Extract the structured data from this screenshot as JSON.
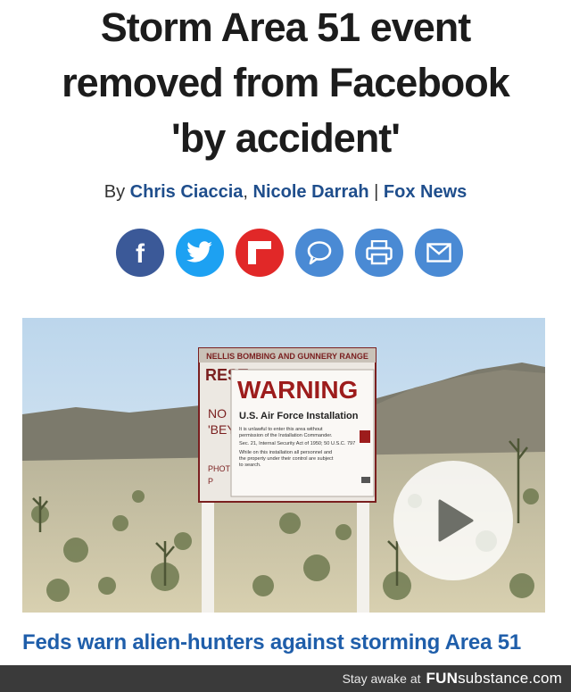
{
  "article": {
    "headline_line1": "Storm Area 51 event",
    "headline_line2": "removed from Facebook",
    "headline_line3": "'by accident'",
    "by_prefix": "By",
    "author1": "Chris Ciaccia",
    "sep1": ", ",
    "author2": "Nicole Darrah",
    "sep2": " | ",
    "outlet": "Fox News"
  },
  "share": {
    "buttons": [
      {
        "icon": "facebook-icon",
        "color": "#3b5998"
      },
      {
        "icon": "twitter-icon",
        "color": "#1da1f2"
      },
      {
        "icon": "flipboard-icon",
        "color": "#e12828"
      },
      {
        "icon": "comment-icon",
        "color": "#4a8ad4"
      },
      {
        "icon": "print-icon",
        "color": "#4a8ad4"
      },
      {
        "icon": "email-icon",
        "color": "#4a8ad4"
      }
    ]
  },
  "sign": {
    "top_text": "NELLIS BOMBING AND GUNNERY RANGE",
    "rest_text": "REST",
    "warning": "WARNING",
    "subtitle": "U.S. Air Force Installation",
    "body1": "It is unlawful to enter this area without",
    "body2": "permission of the Installation Commander.",
    "body3": "Sec. 21, Internal Security Act of 1950; 50 U.S.C. 797",
    "body4": "While on this installation all personnel and",
    "body5": "the property under their control are subject",
    "body6": "to search.",
    "left_no": "NO",
    "left_bey": "'BEY",
    "left_pho": "PHOT",
    "left_p": "P"
  },
  "video": {
    "caption": "Feds warn alien-hunters against storming Area 51",
    "play_icon": "play-icon"
  },
  "footer": {
    "text": "Stay awake at",
    "brand_bold": "FUN",
    "brand_rest": "substance",
    "brand_tld": ".com"
  }
}
